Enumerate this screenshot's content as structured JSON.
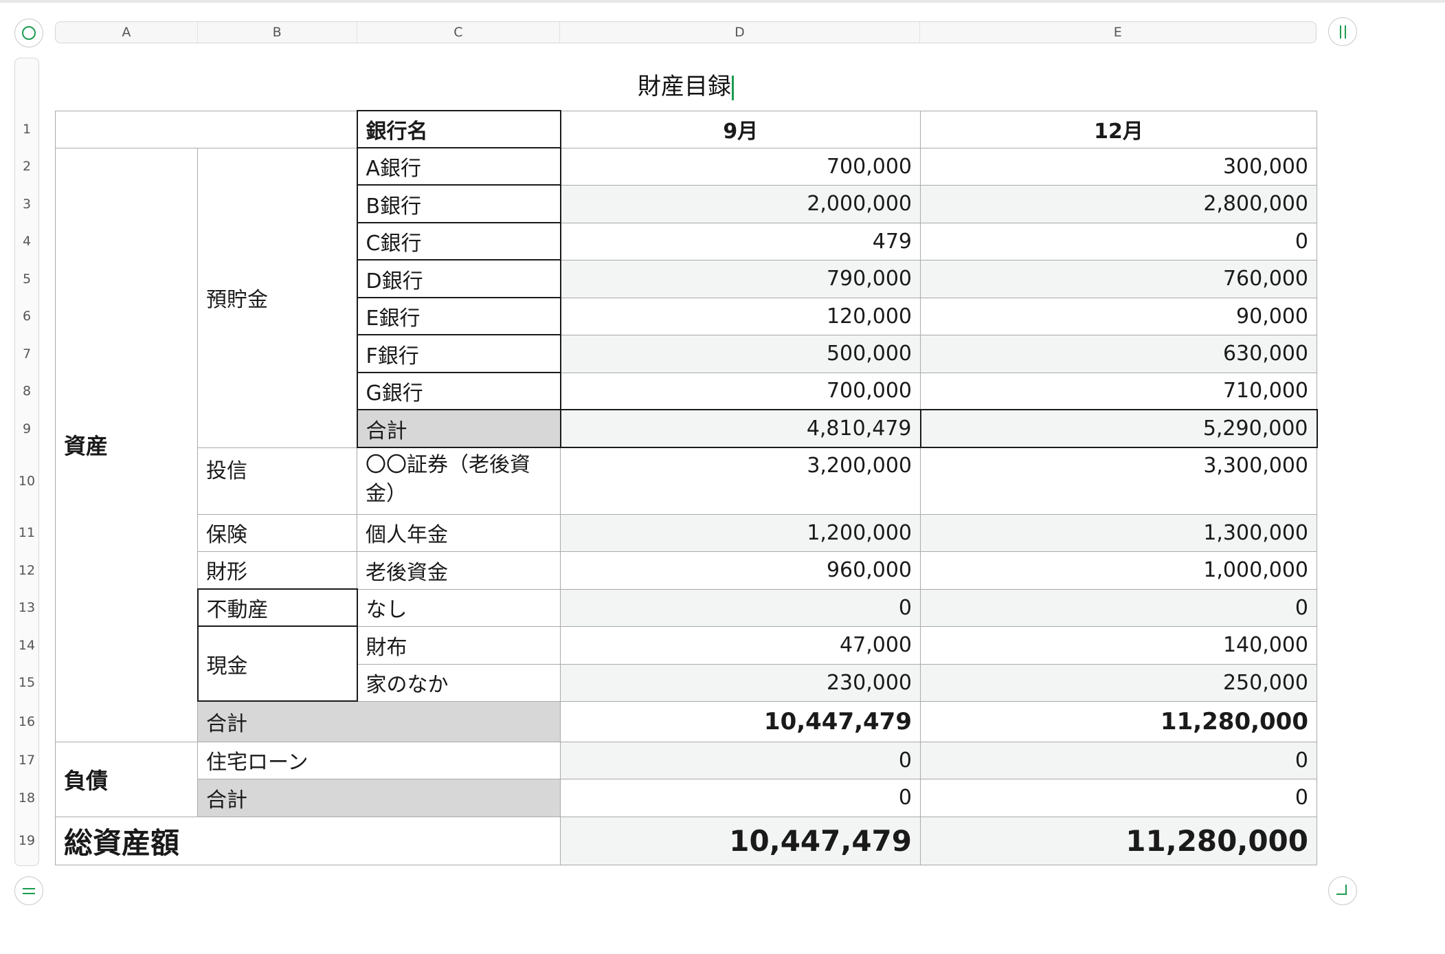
{
  "sheet": {
    "title": "財産目録",
    "columns": [
      "A",
      "B",
      "C",
      "D",
      "E"
    ],
    "rows": [
      "1",
      "2",
      "3",
      "4",
      "5",
      "6",
      "7",
      "8",
      "9",
      "10",
      "11",
      "12",
      "13",
      "14",
      "15",
      "16",
      "17",
      "18",
      "19"
    ]
  },
  "table": {
    "header": {
      "bank_name": "銀行名",
      "sep": "9月",
      "dec": "12月"
    },
    "asset_label": "資産",
    "deposit_label": "預貯金",
    "banks": [
      {
        "name": "A銀行",
        "sep": "700,000",
        "dec": "300,000"
      },
      {
        "name": "B銀行",
        "sep": "2,000,000",
        "dec": "2,800,000"
      },
      {
        "name": "C銀行",
        "sep": "479",
        "dec": "0"
      },
      {
        "name": "D銀行",
        "sep": "790,000",
        "dec": "760,000"
      },
      {
        "name": "E銀行",
        "sep": "120,000",
        "dec": "90,000"
      },
      {
        "name": "F銀行",
        "sep": "500,000",
        "dec": "630,000"
      },
      {
        "name": "G銀行",
        "sep": "700,000",
        "dec": "710,000"
      }
    ],
    "deposit_total": {
      "label": "合計",
      "sep": "4,810,479",
      "dec": "5,290,000"
    },
    "investment": {
      "category": "投信",
      "name": "〇〇証券（老後資金）",
      "sep": "3,200,000",
      "dec": "3,300,000"
    },
    "insurance": {
      "category": "保険",
      "name": "個人年金",
      "sep": "1,200,000",
      "dec": "1,300,000"
    },
    "zaikei": {
      "category": "財形",
      "name": "老後資金",
      "sep": "960,000",
      "dec": "1,000,000"
    },
    "real_estate": {
      "category": "不動産",
      "name": "なし",
      "sep": "0",
      "dec": "0"
    },
    "cash": {
      "category": "現金",
      "items": [
        {
          "name": "財布",
          "sep": "47,000",
          "dec": "140,000"
        },
        {
          "name": "家のなか",
          "sep": "230,000",
          "dec": "250,000"
        }
      ]
    },
    "asset_total": {
      "label": "合計",
      "sep": "10,447,479",
      "dec": "11,280,000"
    },
    "liability_label": "負債",
    "mortgage": {
      "name": "住宅ローン",
      "sep": "0",
      "dec": "0"
    },
    "liability_total": {
      "label": "合計",
      "sep": "0",
      "dec": "0"
    },
    "net_total": {
      "label": "総資産額",
      "sep": "10,447,479",
      "dec": "11,280,000"
    }
  },
  "icons": {
    "top_left": "circle-select-icon",
    "top_right": "column-handle-icon",
    "bottom_left": "row-handle-icon",
    "bottom_right": "resize-corner-icon"
  },
  "colors": {
    "accent": "#1a9b4f",
    "row_alt": "#f2f5f4",
    "total_fill": "#d7d7d7"
  }
}
